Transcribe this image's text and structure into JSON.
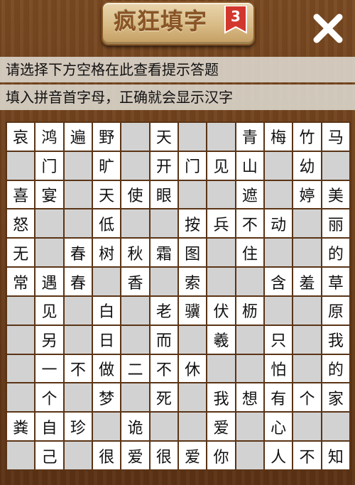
{
  "header": {
    "title": "疯狂填字",
    "level": "3",
    "close_icon": "close-icon",
    "colors": {
      "title": "#8a5424",
      "badge": "#d2372d",
      "close": "#ffffff"
    }
  },
  "hints": {
    "line1": "请选择下方空格在此查看提示答题",
    "line2": "填入拼音首字母，正确就会显示汉字"
  },
  "grid": {
    "rows": 12,
    "cols": 12,
    "cells": [
      [
        "哀",
        "鸿",
        "遍",
        "野",
        "",
        "天",
        "",
        "",
        "青",
        "梅",
        "竹",
        "马"
      ],
      [
        "",
        "门",
        "",
        "旷",
        "",
        "开",
        "门",
        "见",
        "山",
        "",
        "幼",
        ""
      ],
      [
        "喜",
        "宴",
        "",
        "天",
        "使",
        "眼",
        "",
        "",
        "遮",
        "",
        "婷",
        "美"
      ],
      [
        "怒",
        "",
        "",
        "低",
        "",
        "",
        "按",
        "兵",
        "不",
        "动",
        "",
        "丽"
      ],
      [
        "无",
        "",
        "春",
        "树",
        "秋",
        "霜",
        "图",
        "",
        "住",
        "",
        "",
        "的"
      ],
      [
        "常",
        "遇",
        "春",
        "",
        "香",
        "",
        "索",
        "",
        "",
        "含",
        "羞",
        "草"
      ],
      [
        "",
        "见",
        "",
        "白",
        "",
        "老",
        "骥",
        "伏",
        "枥",
        "",
        "",
        "原"
      ],
      [
        "",
        "另",
        "",
        "日",
        "",
        "而",
        "",
        "羲",
        "",
        "只",
        "",
        "我"
      ],
      [
        "",
        "一",
        "不",
        "做",
        "二",
        "不",
        "休",
        "",
        "",
        "怕",
        "",
        "的"
      ],
      [
        "",
        "个",
        "",
        "梦",
        "",
        "死",
        "",
        "我",
        "想",
        "有",
        "个",
        "家"
      ],
      [
        "粪",
        "自",
        "珍",
        "",
        "诡",
        "",
        "",
        "爱",
        "",
        "心",
        "",
        ""
      ],
      [
        "",
        "己",
        "",
        "很",
        "爱",
        "很",
        "爱",
        "你",
        "",
        "人",
        "不",
        "知"
      ]
    ],
    "colors": {
      "filled": "#ffffff",
      "blank": "#d2d2d2",
      "border": "#5a3416"
    }
  }
}
